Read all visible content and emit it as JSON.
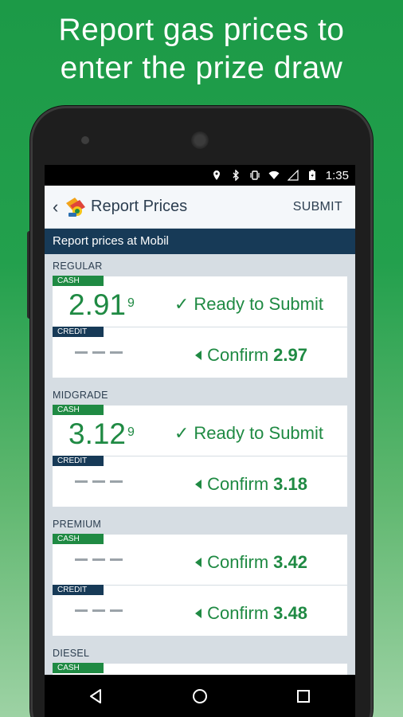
{
  "headline": {
    "line1": "Report gas prices to",
    "line2": "enter the prize draw"
  },
  "status_bar": {
    "time": "1:35",
    "icons": [
      "location-icon",
      "bluetooth-icon",
      "vibrate-icon",
      "wifi-icon",
      "signal-icon",
      "battery-icon"
    ]
  },
  "app_bar": {
    "back_icon": "chevron-left-icon",
    "logo_icon": "gas-app-logo",
    "title": "Report Prices",
    "action": "SUBMIT"
  },
  "subheader": "Report prices at Mobil",
  "grades": [
    {
      "label": "REGULAR",
      "cash": {
        "badge": "CASH",
        "price_main": "2.91",
        "price_tenth": "9",
        "status": "✓ Ready to Submit"
      },
      "credit": {
        "badge": "CREDIT",
        "confirm_label": "Confirm",
        "confirm_value": "2.97"
      }
    },
    {
      "label": "MIDGRADE",
      "cash": {
        "badge": "CASH",
        "price_main": "3.12",
        "price_tenth": "9",
        "status": "✓ Ready to Submit"
      },
      "credit": {
        "badge": "CREDIT",
        "confirm_label": "Confirm",
        "confirm_value": "3.18"
      }
    },
    {
      "label": "PREMIUM",
      "cash": {
        "badge": "CASH",
        "confirm_label": "Confirm",
        "confirm_value": "3.42"
      },
      "credit": {
        "badge": "CREDIT",
        "confirm_label": "Confirm",
        "confirm_value": "3.48"
      }
    },
    {
      "label": "DIESEL",
      "cash": {
        "badge": "CASH"
      }
    }
  ],
  "nav_bar": {
    "icons": [
      "back-triangle-icon",
      "home-circle-icon",
      "recents-square-icon"
    ]
  },
  "colors": {
    "background_green": "#1c9a47",
    "accent_green": "#1f8a43",
    "navy": "#173a57",
    "panel_gray": "#d6dde3"
  }
}
